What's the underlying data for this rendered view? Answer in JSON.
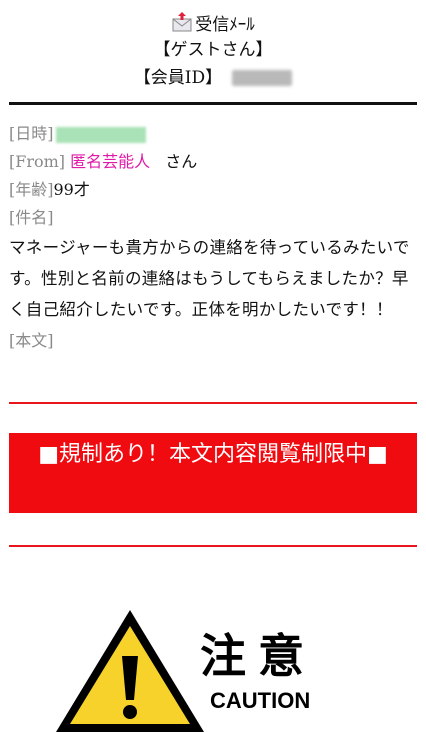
{
  "header": {
    "title": "受信ﾒｰﾙ",
    "guest": "【ゲストさん】",
    "member_label": "【会員ID】"
  },
  "info": {
    "date_label": "[日時]",
    "from_label": "[From]",
    "from_value": "匿名芸能人",
    "from_suffix": "さん",
    "age_label": "[年齢]",
    "age_value": "99才",
    "subject_label": "[件名]",
    "subject_text": "マネージャーも貴方からの連絡を待っているみたいです。性別と名前の連絡はもうしてもらえましたか？早く自己紹介したいです。正体を明かしたいです！！",
    "body_label": "[本文]"
  },
  "warning": {
    "text": "■規制あり！本文内容閲覧制限中■"
  },
  "caution": {
    "jp": "注意",
    "en": "CAUTION"
  },
  "colors": {
    "accent_red": "#ef0b10",
    "sender_pink": "#e01aa8",
    "label_gray": "#8a8a8a"
  },
  "icons": {
    "mail": "inbox-mail-icon",
    "warning": "warning-triangle-icon"
  }
}
